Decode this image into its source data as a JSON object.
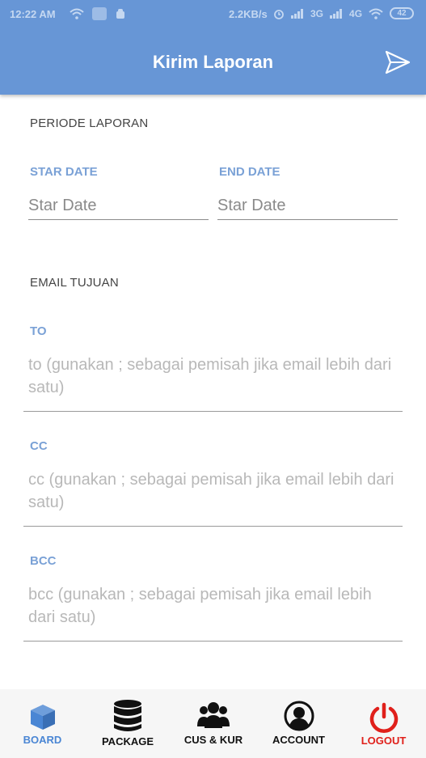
{
  "status_bar": {
    "time": "12:22 AM",
    "speed": "2.2KB/s",
    "network_1": "3G",
    "network_2": "4G",
    "battery": "42"
  },
  "app_bar": {
    "title": "Kirim Laporan",
    "send_icon": "send-icon"
  },
  "periode": {
    "title": "PERIODE LAPORAN",
    "start": {
      "label": "STAR DATE",
      "placeholder": "Star Date"
    },
    "end": {
      "label": "END DATE",
      "placeholder": "Star Date"
    }
  },
  "email": {
    "title": "EMAIL TUJUAN",
    "to": {
      "label": "TO",
      "placeholder": "to (gunakan ; sebagai pemisah jika email lebih dari satu)"
    },
    "cc": {
      "label": "CC",
      "placeholder": "cc (gunakan ; sebagai pemisah jika email lebih dari satu)"
    },
    "bcc": {
      "label": "BCC",
      "placeholder": "bcc (gunakan ; sebagai pemisah jika email lebih dari satu)"
    }
  },
  "bottom_nav": {
    "items": [
      {
        "label": "BOARD",
        "icon": "cube-icon",
        "color": "#4a86d4"
      },
      {
        "label": "PACKAGE",
        "icon": "database-icon",
        "color": "#111111"
      },
      {
        "label": "CUS & KUR",
        "icon": "users-icon",
        "color": "#111111"
      },
      {
        "label": "ACCOUNT",
        "icon": "user-circle-icon",
        "color": "#111111"
      },
      {
        "label": "LOGOUT",
        "icon": "power-icon",
        "color": "#e0201b"
      }
    ]
  },
  "colors": {
    "app_bar": "#6796d6",
    "label_accent": "#7aa1d6",
    "active_nav": "#4a86d4",
    "logout": "#e0201b"
  }
}
